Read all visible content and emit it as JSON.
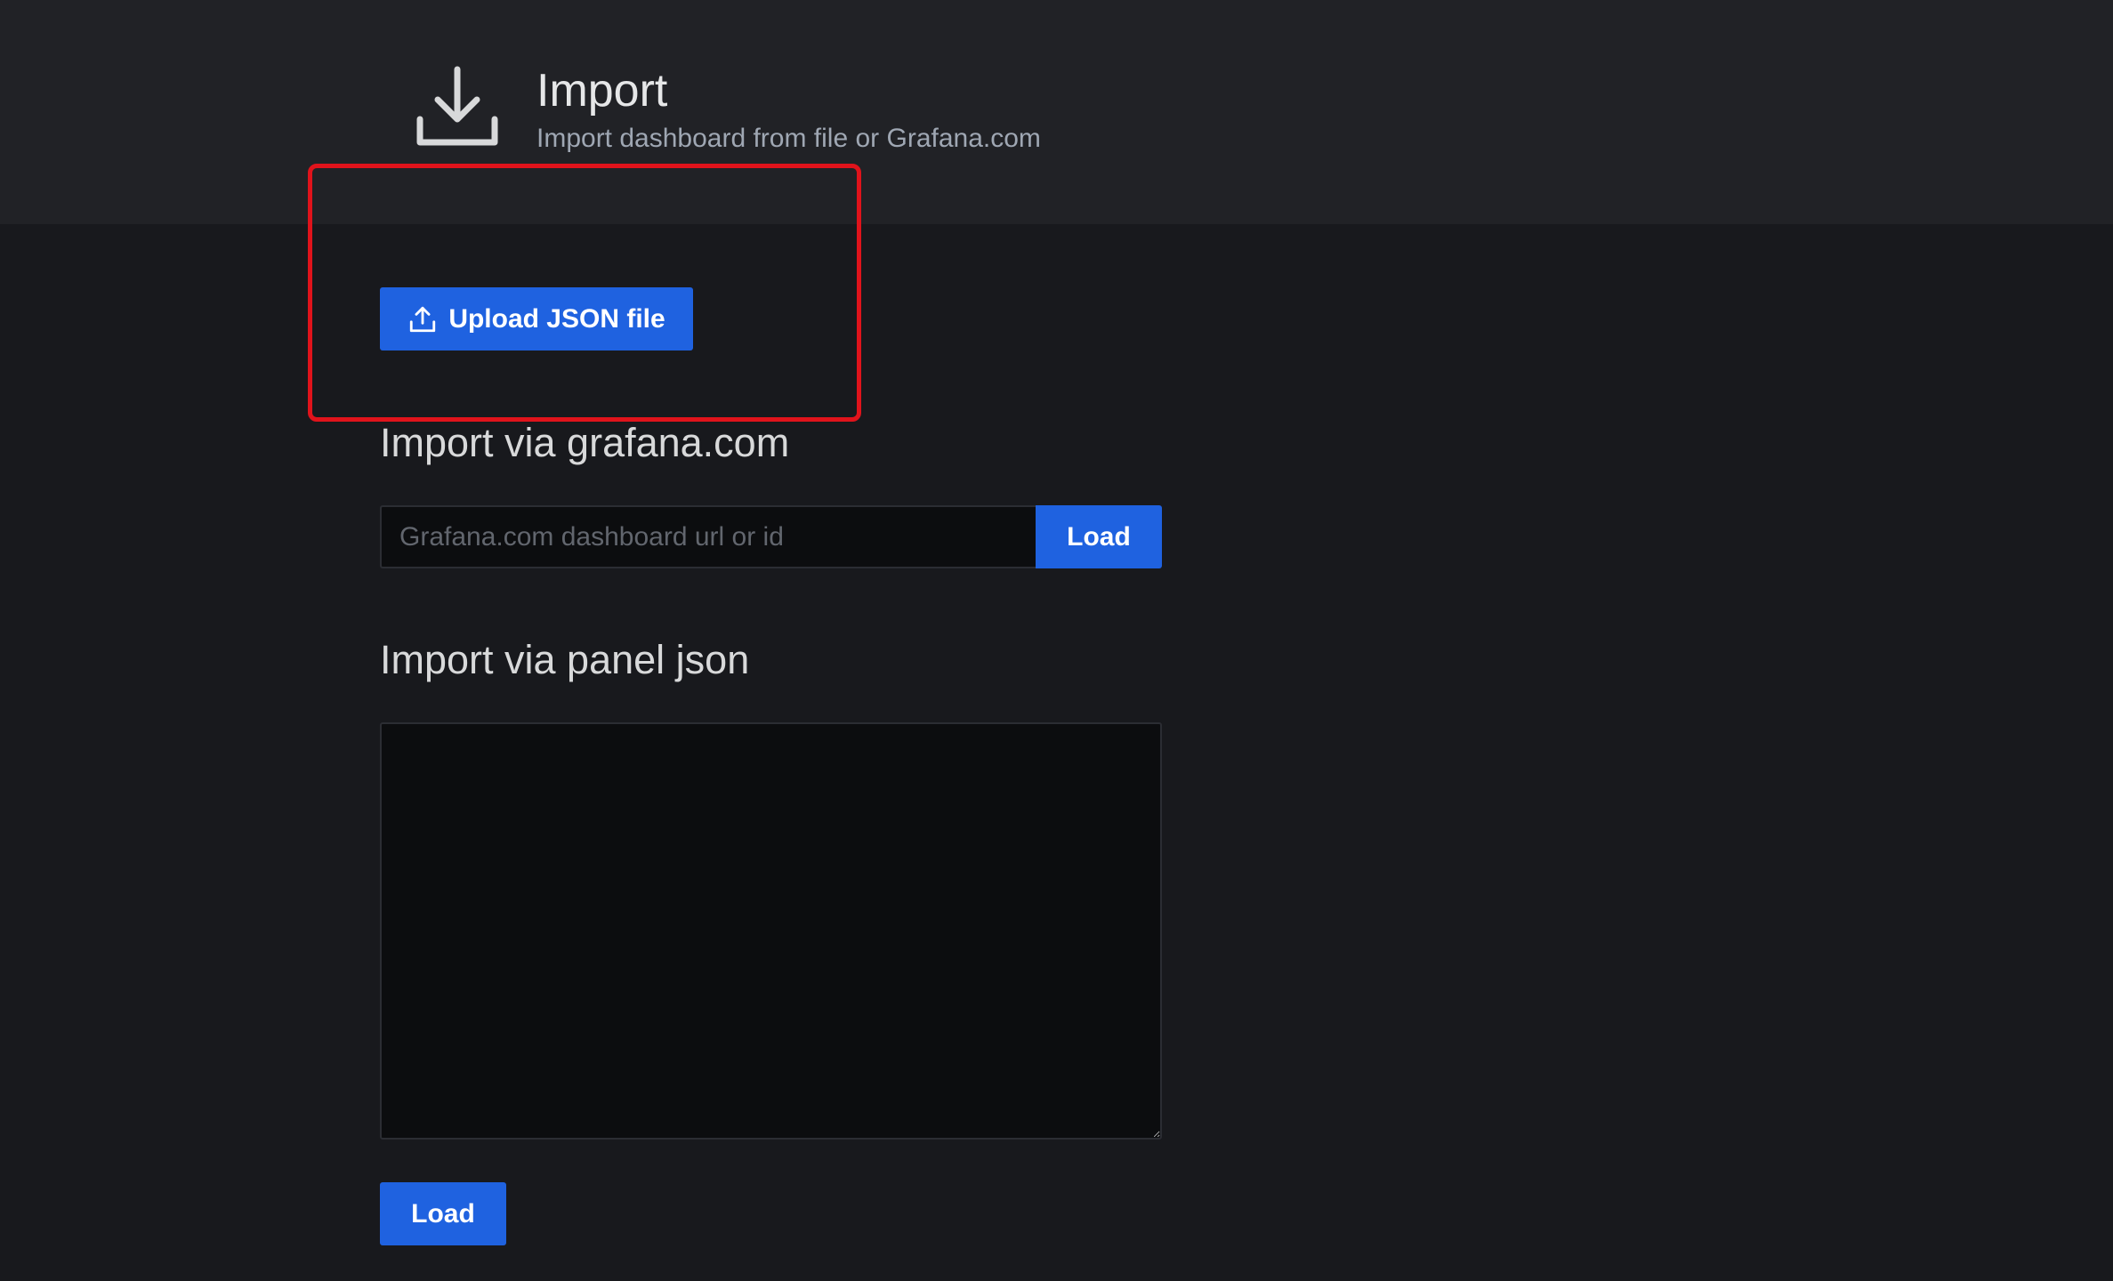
{
  "header": {
    "title": "Import",
    "subtitle": "Import dashboard from file or Grafana.com",
    "icon": "download-icon"
  },
  "upload": {
    "label": "Upload JSON file",
    "icon": "upload-icon"
  },
  "grafana_com": {
    "title": "Import via grafana.com",
    "placeholder": "Grafana.com dashboard url or id",
    "value": "",
    "load_label": "Load"
  },
  "panel_json": {
    "title": "Import via panel json",
    "value": "",
    "load_label": "Load"
  },
  "colors": {
    "primary_button": "#1f62e0",
    "highlight": "#e0131b",
    "header_bg": "#212226",
    "page_bg": "#18191d"
  }
}
